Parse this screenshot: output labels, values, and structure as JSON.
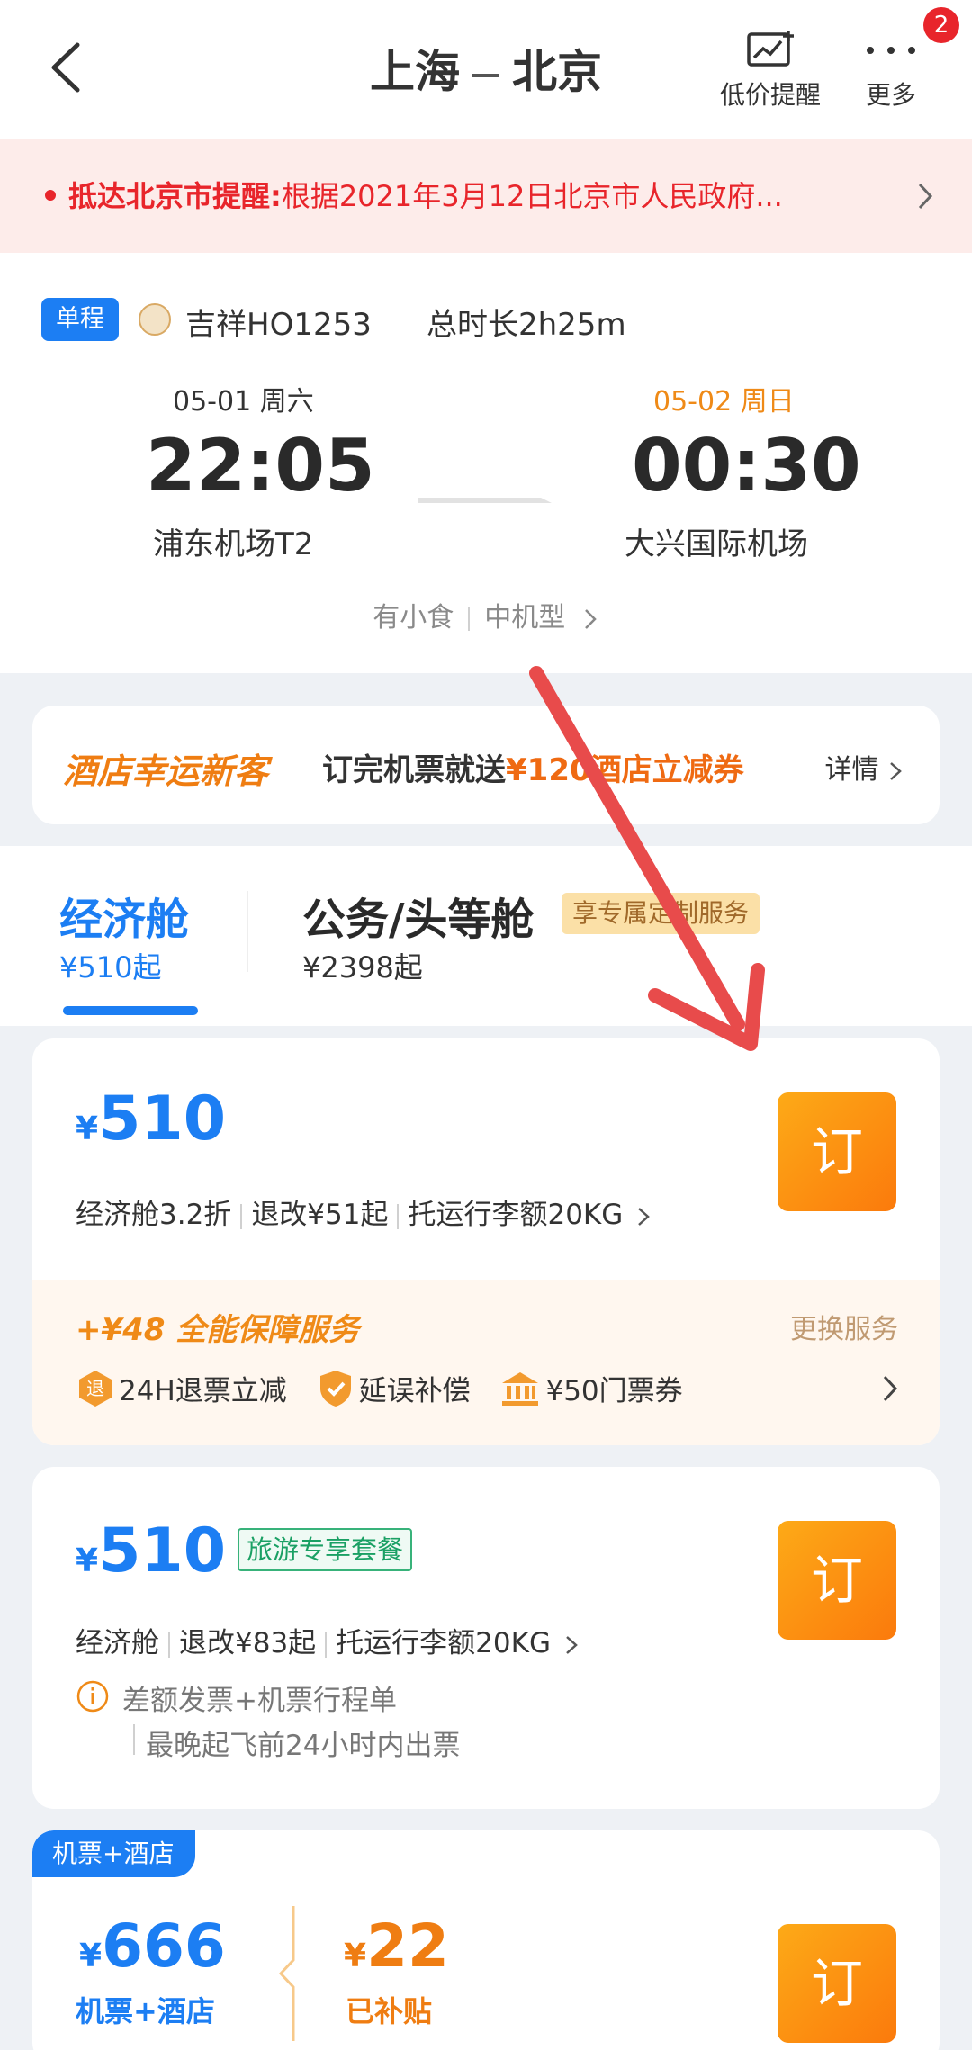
{
  "header": {
    "title_from": "上海",
    "title_to": "北京",
    "price_alert_label": "低价提醒",
    "more_label": "更多",
    "more_badge": "2"
  },
  "notice": {
    "lead": "抵达北京市提醒:",
    "text": "根据2021年3月12日北京市人民政府..."
  },
  "flight": {
    "tag": "单程",
    "airline": "吉祥HO1253",
    "duration": "总时长2h25m",
    "departure": {
      "date": "05-01 周六",
      "time": "22:05",
      "airport": "浦东机场T2"
    },
    "arrival": {
      "date": "05-02 周日",
      "time": "00:30",
      "airport": "大兴国际机场"
    },
    "meal": "有小食",
    "aircraft": "中机型"
  },
  "promo": {
    "title": "酒店幸运新客",
    "text_pre": "订完机票就送",
    "text_highlight": "¥120酒店立减券",
    "details": "详情"
  },
  "cabins": {
    "economy": {
      "label": "经济舱",
      "price": "¥510起"
    },
    "business": {
      "label": "公务/头等舱",
      "tag": "享专属定制服务",
      "price": "¥2398起"
    }
  },
  "fares": [
    {
      "yen": "¥",
      "price": "510",
      "info": [
        "经济舱3.2折",
        "退改¥51起",
        "托运行李额20KG"
      ],
      "book": "订",
      "protection": {
        "title": "+¥48 全能保障服务",
        "change": "更换服务",
        "items": [
          {
            "icon": "refund-icon",
            "label": "24H退票立减"
          },
          {
            "icon": "shield-check-icon",
            "label": "延误补偿"
          },
          {
            "icon": "museum-icon",
            "label": "¥50门票券"
          }
        ]
      }
    },
    {
      "yen": "¥",
      "price": "510",
      "tag": "旅游专享套餐",
      "info": [
        "经济舱",
        "退改¥83起",
        "托运行李额20KG"
      ],
      "note1": "差额发票+机票行程单",
      "note2": "最晚起飞前24小时内出票",
      "book": "订"
    },
    {
      "combo_tag": "机票+酒店",
      "yen": "¥",
      "price": "666",
      "price_label": "机票+酒店",
      "subsidy_yen": "¥",
      "subsidy": "22",
      "subsidy_label": "已补贴",
      "book": "订"
    }
  ],
  "colors": {
    "brand_blue": "#1c7ef3",
    "orange": "#fb7a0c",
    "red": "#e8252b",
    "annotation_arrow": "#e84b4b"
  }
}
